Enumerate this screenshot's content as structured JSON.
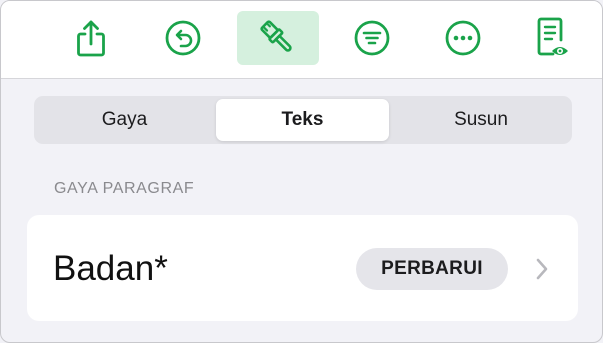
{
  "colors": {
    "accent": "#1aa34a",
    "active_tool_bg": "#d5f0de",
    "panel_bg": "#f2f2f7"
  },
  "toolbar": {
    "buttons": [
      {
        "icon": "share-icon"
      },
      {
        "icon": "undo-icon"
      },
      {
        "icon": "paintbrush-icon",
        "active": true
      },
      {
        "icon": "insert-icon"
      },
      {
        "icon": "more-icon"
      },
      {
        "icon": "reading-view-icon"
      }
    ]
  },
  "tabs": {
    "gaya": "Gaya",
    "teks": "Teks",
    "susun": "Susun",
    "selected": "Teks"
  },
  "paragraph_style": {
    "header": "GAYA PARAGRAF",
    "name": "Badan*",
    "update_label": "PERBARUI",
    "chevron_icon": "chevron-right-icon"
  }
}
